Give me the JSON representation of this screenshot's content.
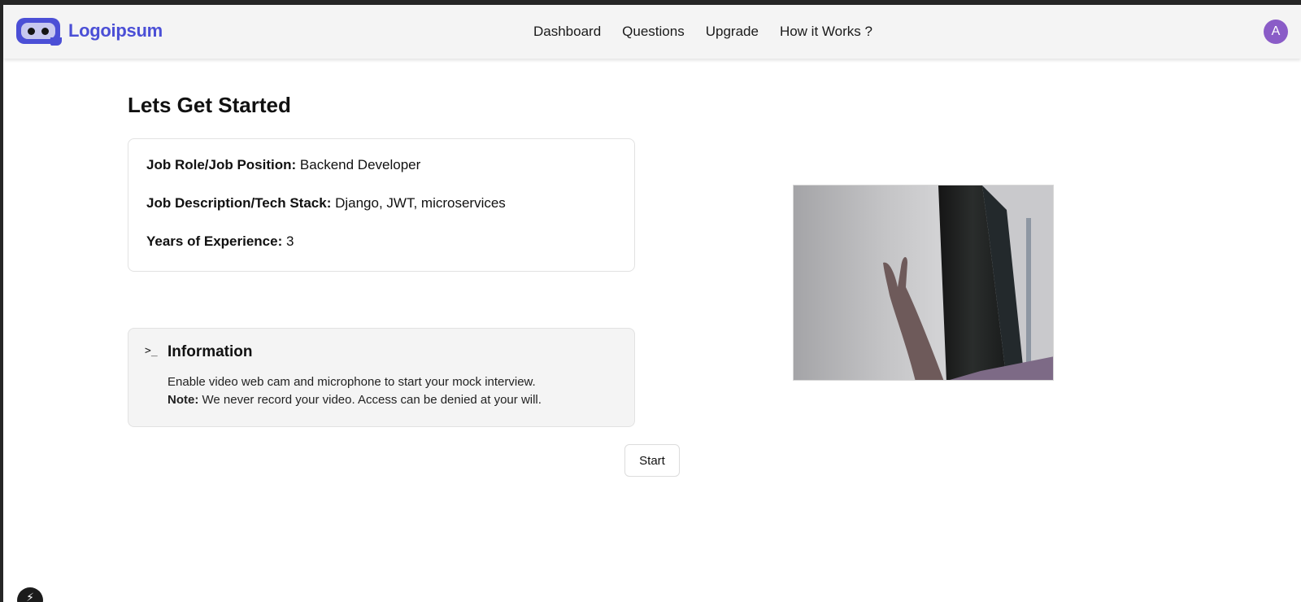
{
  "header": {
    "logo_text": "Logoipsum",
    "nav": [
      {
        "label": "Dashboard"
      },
      {
        "label": "Questions"
      },
      {
        "label": "Upgrade"
      },
      {
        "label": "How it Works ?"
      }
    ],
    "avatar_initial": "A"
  },
  "main": {
    "title": "Lets Get Started",
    "details": {
      "job_role_label": "Job Role/Job Position:",
      "job_role_value": "Backend Developer",
      "job_desc_label": "Job Description/Tech Stack:",
      "job_desc_value": "Django, JWT, microservices",
      "experience_label": "Years of Experience:",
      "experience_value": "3"
    },
    "info": {
      "icon": "terminal-icon",
      "title": "Information",
      "body": "Enable video web cam and microphone to start your mock interview.",
      "note_label": "Note:",
      "note_text": "We never record your video. Access can be denied at your will."
    },
    "start_label": "Start"
  },
  "colors": {
    "brand": "#4b4fd6",
    "avatar": "#8a5cc7",
    "header_bg": "#f4f4f4",
    "info_bg": "#f4f4f4"
  }
}
